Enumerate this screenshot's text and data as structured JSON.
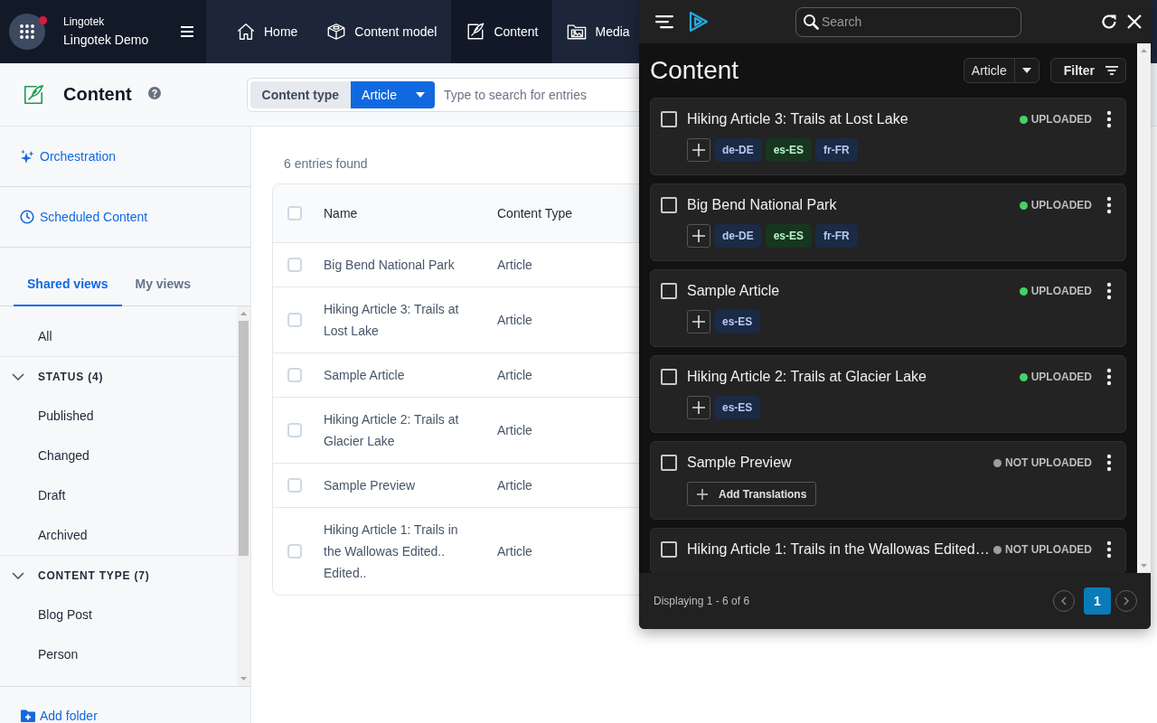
{
  "header": {
    "org": "Lingotek",
    "space": "Lingotek Demo",
    "unread_notice": true,
    "nav": [
      {
        "label": "Home",
        "selected": false
      },
      {
        "label": "Content model",
        "selected": false
      },
      {
        "label": "Content",
        "selected": true
      },
      {
        "label": "Media",
        "selected": false
      }
    ]
  },
  "page_header": {
    "title": "Content",
    "search": {
      "content_type_label": "Content type",
      "content_type_value": "Article",
      "placeholder": "Type to search for entries"
    }
  },
  "sidebar": {
    "links": [
      "Orchestration",
      "Scheduled Content"
    ],
    "tabs": [
      {
        "label": "Shared views",
        "selected": true
      },
      {
        "label": "My views",
        "selected": false
      }
    ],
    "views": [
      {
        "kind": "view",
        "label": "All",
        "selected": false
      },
      {
        "kind": "group",
        "label": "STATUS (4)",
        "expanded": true,
        "children": [
          {
            "kind": "view",
            "label": "Published",
            "selected": false
          },
          {
            "kind": "view",
            "label": "Changed",
            "selected": false
          },
          {
            "kind": "view",
            "label": "Draft",
            "selected": false
          },
          {
            "kind": "view",
            "label": "Archived",
            "selected": false
          }
        ]
      },
      {
        "kind": "group",
        "label": "CONTENT TYPE (7)",
        "expanded": true,
        "children": [
          {
            "kind": "view",
            "label": "Blog Post",
            "selected": false
          },
          {
            "kind": "view",
            "label": "Person",
            "selected": false
          }
        ]
      }
    ],
    "add_folder": "Add folder"
  },
  "entries": {
    "count": "6 entries found",
    "select_all": false,
    "columns": [
      "Name",
      "Content Type"
    ],
    "rows": [
      {
        "cells": [
          "Big Bend National Park",
          "Article"
        ],
        "selected": false
      },
      {
        "cells": [
          "Hiking Article 3: Trails at Lost Lake",
          "Article"
        ],
        "selected": false
      },
      {
        "cells": [
          "Sample Article",
          "Article"
        ],
        "selected": false
      },
      {
        "cells": [
          "Hiking Article 2: Trails at Glacier Lake",
          "Article"
        ],
        "selected": false
      },
      {
        "cells": [
          "Sample Preview",
          "Article"
        ],
        "selected": false
      },
      {
        "cells": [
          "Hiking Article 1: Trails in the Wallowas Edited.. Edited..",
          "Article"
        ],
        "selected": false
      }
    ]
  },
  "panel": {
    "search_placeholder": "Search",
    "title": "Content",
    "type_filter": "Article",
    "filter_label": "Filter",
    "cards": [
      {
        "title": "Hiking Article 3: Trails at Lost Lake",
        "checked": false,
        "status": {
          "label": "UPLOADED",
          "color": "#45d264"
        },
        "translations": [
          {
            "label": "de-DE",
            "color": "#1b2a45"
          },
          {
            "label": "es-ES",
            "color": "#17361f"
          },
          {
            "label": "fr-FR",
            "color": "#1b2a45"
          }
        ]
      },
      {
        "title": "Big Bend National Park",
        "checked": false,
        "status": {
          "label": "UPLOADED",
          "color": "#45d264"
        },
        "translations": [
          {
            "label": "de-DE",
            "color": "#1b2a45"
          },
          {
            "label": "es-ES",
            "color": "#17361f"
          },
          {
            "label": "fr-FR",
            "color": "#1b2a45"
          }
        ]
      },
      {
        "title": "Sample Article",
        "checked": false,
        "status": {
          "label": "UPLOADED",
          "color": "#45d264"
        },
        "translations": [
          {
            "label": "es-ES",
            "color": "#1b2a45"
          }
        ]
      },
      {
        "title": "Hiking Article 2: Trails at Glacier Lake",
        "checked": false,
        "status": {
          "label": "UPLOADED",
          "color": "#45d264"
        },
        "translations": [
          {
            "label": "es-ES",
            "color": "#1b2a45"
          }
        ]
      },
      {
        "title": "Sample Preview",
        "checked": false,
        "status": {
          "label": "NOT UPLOADED",
          "color": "#9e9e9e"
        },
        "add_translations_label": "Add Translations"
      },
      {
        "title": "Hiking Article 1: Trails in the Wallowas Edited…",
        "checked": false,
        "status": {
          "label": "NOT UPLOADED",
          "color": "#9e9e9e"
        }
      }
    ],
    "summary": "Displaying 1 - 6 of 6",
    "pages": [
      {
        "label": "1",
        "selected": true
      }
    ]
  }
}
